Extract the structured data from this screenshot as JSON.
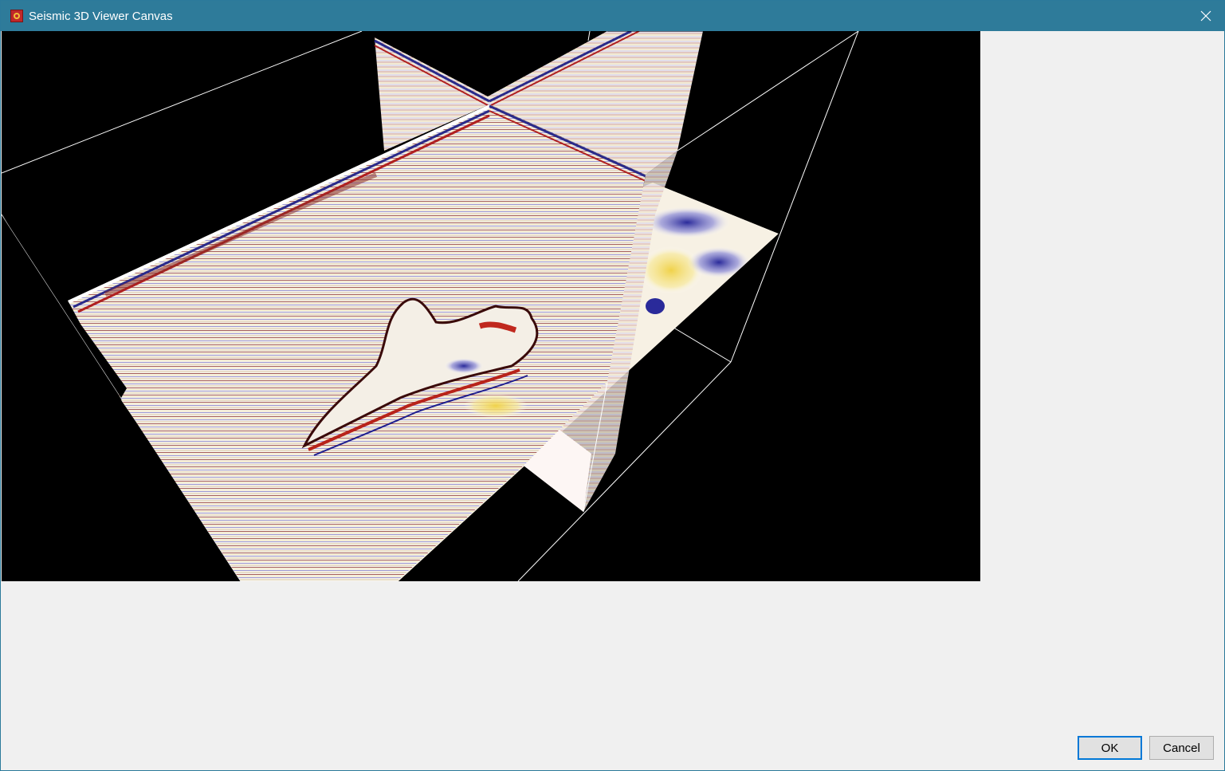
{
  "window": {
    "title": "Seismic 3D Viewer Canvas",
    "title_bar_color": "#2e7b9a"
  },
  "viewer": {
    "background": "#000000",
    "palette": [
      "#1f1f8f",
      "#7b7bd4",
      "#ffffff",
      "#f3e37a",
      "#c0281e",
      "#5a0d0d"
    ]
  },
  "dialog_buttons": {
    "ok_label": "OK",
    "cancel_label": "Cancel"
  }
}
